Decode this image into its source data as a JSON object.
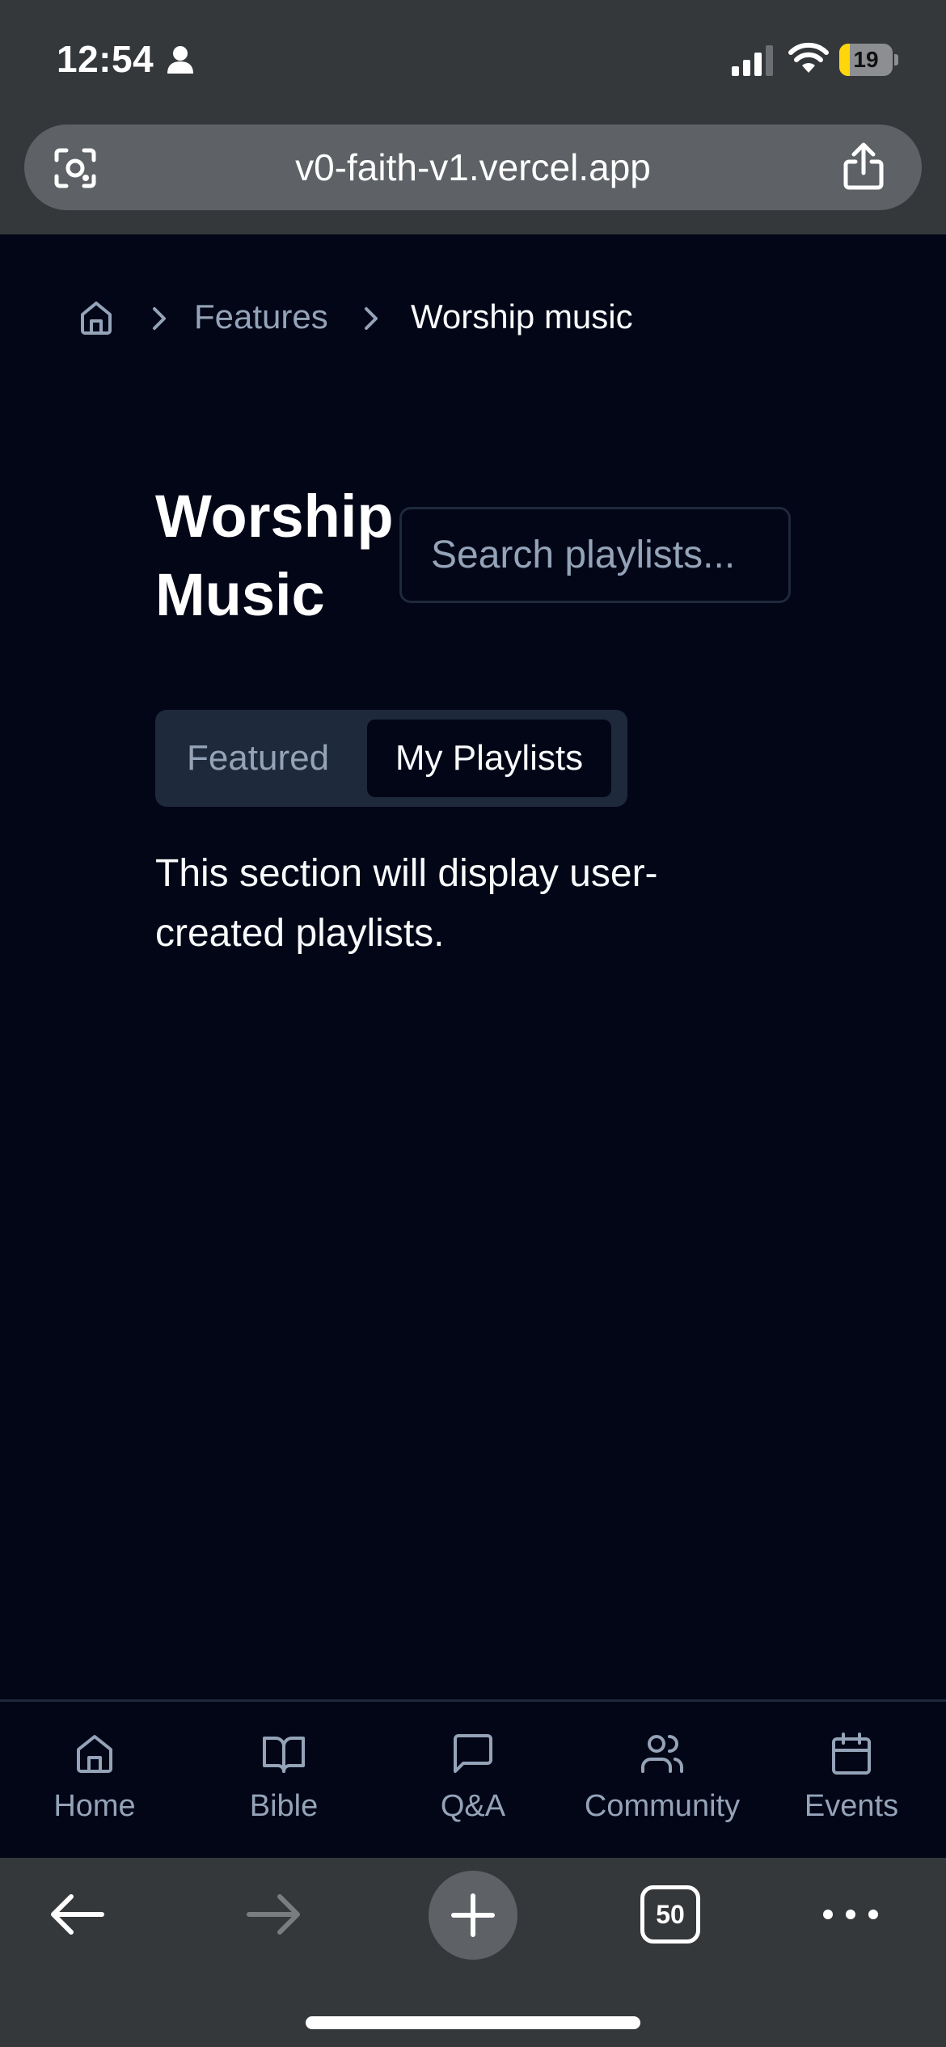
{
  "status_bar": {
    "time": "12:54",
    "battery_level": "19",
    "battery_fraction": 0.19,
    "icons": [
      "person-icon",
      "signal-icon",
      "wifi-icon",
      "battery-icon"
    ]
  },
  "browser": {
    "url": "v0-faith-v1.vercel.app",
    "icons": [
      "lens-icon",
      "share-icon"
    ],
    "toolbar": {
      "tab_count": "50",
      "icons": [
        "back-arrow-icon",
        "forward-arrow-icon",
        "plus-icon",
        "tabs-icon",
        "more-icon"
      ]
    }
  },
  "breadcrumb": {
    "home_icon": "home-icon",
    "items": [
      "Features",
      "Worship music"
    ]
  },
  "main": {
    "title": "Worship Music",
    "search": {
      "placeholder": "Search playlists...",
      "value": ""
    },
    "tabs": [
      {
        "label": "Featured",
        "active": false
      },
      {
        "label": "My Playlists",
        "active": true
      }
    ],
    "section_text": "This section will display user-created playlists."
  },
  "bottom_nav": {
    "items": [
      {
        "label": "Home",
        "icon": "home-icon"
      },
      {
        "label": "Bible",
        "icon": "book-icon"
      },
      {
        "label": "Q&A",
        "icon": "message-icon"
      },
      {
        "label": "Community",
        "icon": "users-icon"
      },
      {
        "label": "Events",
        "icon": "calendar-icon"
      }
    ]
  },
  "colors": {
    "background": "#020617",
    "muted_text": "#94a3b8",
    "border": "#1e293b",
    "browser_chrome": "#35383b",
    "battery_accent": "#ffd60a"
  }
}
